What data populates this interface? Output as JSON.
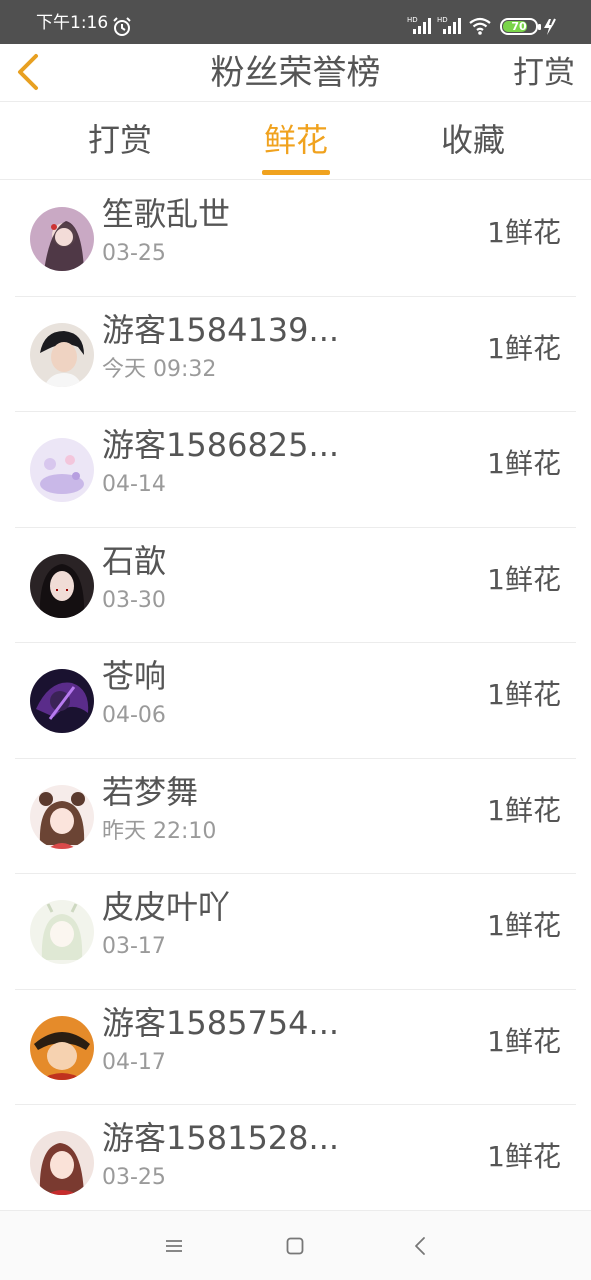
{
  "status_bar": {
    "time": "下午1:16",
    "battery": "70"
  },
  "header": {
    "title": "粉丝荣誉榜",
    "action": "打赏"
  },
  "tabs": [
    {
      "label": "打赏"
    },
    {
      "label": "鲜花"
    },
    {
      "label": "收藏"
    }
  ],
  "active_tab": "鲜花",
  "colors": {
    "accent": "#f0a21e",
    "text": "#555555",
    "subtext": "#9a9a9a",
    "status_bar": "#505050"
  },
  "list": [
    {
      "name": "笙歌乱世",
      "date": "03-25",
      "amount": "1鲜花"
    },
    {
      "name": "游客1584139...",
      "date": "今天 09:32",
      "amount": "1鲜花"
    },
    {
      "name": "游客1586825...",
      "date": "04-14",
      "amount": "1鲜花"
    },
    {
      "name": "石歆",
      "date": "03-30",
      "amount": "1鲜花"
    },
    {
      "name": "苍响",
      "date": "04-06",
      "amount": "1鲜花"
    },
    {
      "name": "若梦舞",
      "date": "昨天 22:10",
      "amount": "1鲜花"
    },
    {
      "name": "皮皮叶吖",
      "date": "03-17",
      "amount": "1鲜花"
    },
    {
      "name": "游客1585754...",
      "date": "04-17",
      "amount": "1鲜花"
    },
    {
      "name": "游客1581528...",
      "date": "03-25",
      "amount": "1鲜花"
    }
  ]
}
